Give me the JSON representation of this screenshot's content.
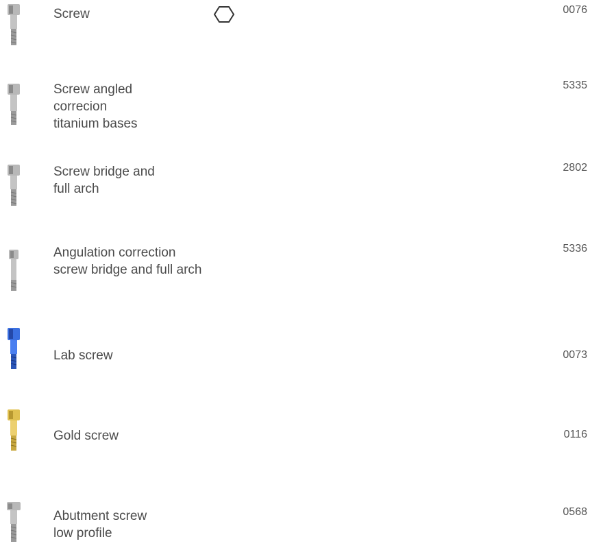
{
  "items": [
    {
      "name": "Screw",
      "code": "0076",
      "color": "silver",
      "icon": "hexagon-icon"
    },
    {
      "name": "Screw angled\ncorrecion\ntitanium bases",
      "code": "5335",
      "color": "silver"
    },
    {
      "name": "Screw bridge and\nfull arch",
      "code": "2802",
      "color": "silver"
    },
    {
      "name": "Angulation correction\nscrew bridge and full arch",
      "code": "5336",
      "color": "silver"
    },
    {
      "name": "Lab screw",
      "code": "0073",
      "color": "blue"
    },
    {
      "name": "Gold screw",
      "code": "0116",
      "color": "gold"
    },
    {
      "name": "Abutment screw\nlow profile",
      "code": "0568",
      "color": "silver"
    }
  ],
  "colors": {
    "silver": "#a8a8a8",
    "blue": "#2f5fd0",
    "gold": "#d9b84a",
    "text": "#4a4a4a"
  }
}
